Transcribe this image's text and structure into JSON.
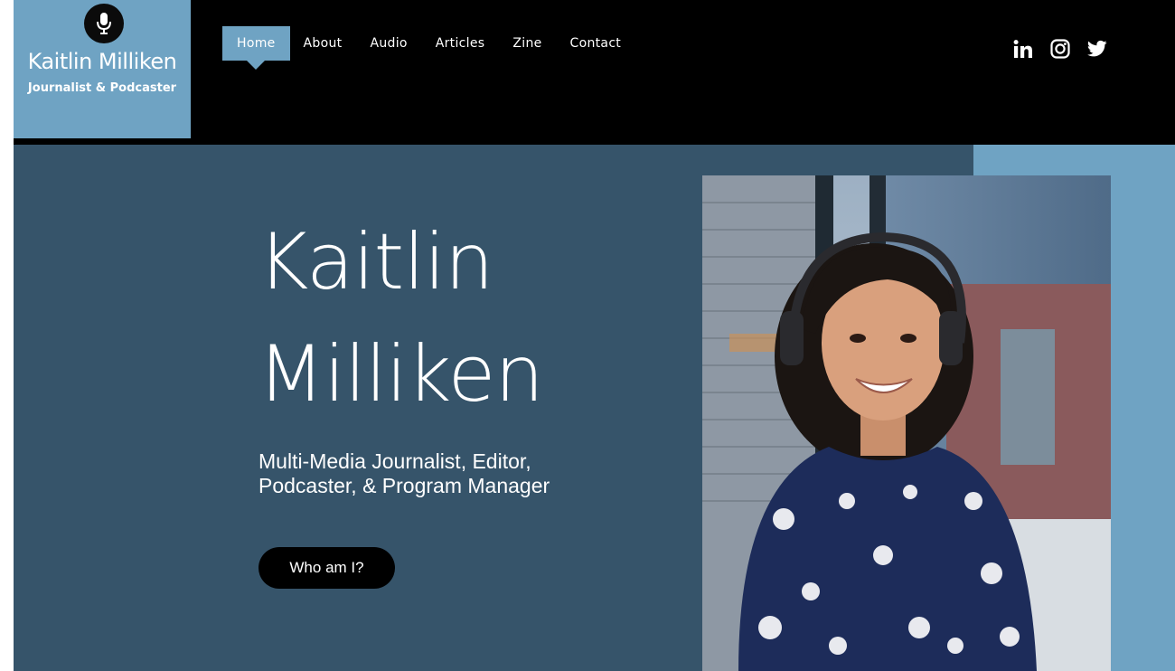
{
  "logo": {
    "name": "Kaitlin Milliken",
    "tagline": "Journalist & Podcaster",
    "icon": "microphone-icon",
    "background_color": "#6fa3c3"
  },
  "nav": {
    "items": [
      {
        "label": "Home",
        "active": true
      },
      {
        "label": "About",
        "active": false
      },
      {
        "label": "Audio",
        "active": false
      },
      {
        "label": "Articles",
        "active": false
      },
      {
        "label": "Zine",
        "active": false
      },
      {
        "label": "Contact",
        "active": false
      }
    ]
  },
  "social": {
    "icons": [
      "linkedin-icon",
      "instagram-icon",
      "twitter-icon"
    ]
  },
  "hero": {
    "title_line1": "Kaitlin",
    "title_line2": "Milliken",
    "subtitle_line1": "Multi-Media Journalist, Editor,",
    "subtitle_line2": "Podcaster, & Program Manager",
    "cta_label": "Who am I?",
    "background_color": "#36546a",
    "accent_color": "#6fa3c3"
  },
  "portrait": {
    "alt": "Portrait photo of Kaitlin Milliken wearing headphones"
  }
}
